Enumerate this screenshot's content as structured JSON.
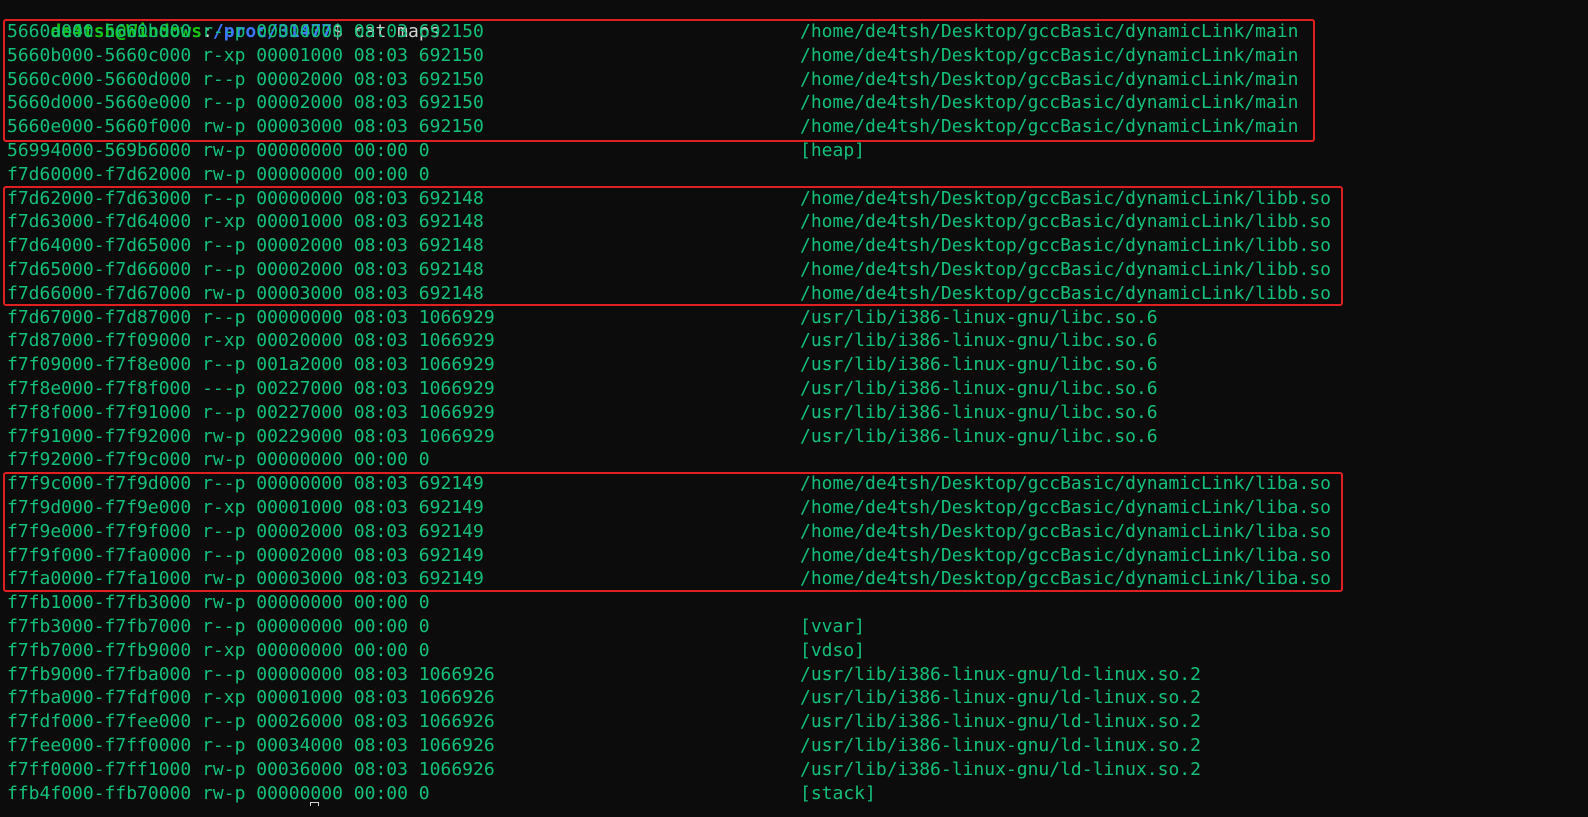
{
  "prompt": {
    "user_host": "de4tsh@Windows",
    "separator": ":",
    "path": "/proc/31477",
    "dollar": "$ ",
    "command": "cat maps"
  },
  "rows": [
    {
      "cols": "5660a000-5660b000 r--p 00000000 08:03 692150",
      "path": "/home/de4tsh/Desktop/gccBasic/dynamicLink/main"
    },
    {
      "cols": "5660b000-5660c000 r-xp 00001000 08:03 692150",
      "path": "/home/de4tsh/Desktop/gccBasic/dynamicLink/main"
    },
    {
      "cols": "5660c000-5660d000 r--p 00002000 08:03 692150",
      "path": "/home/de4tsh/Desktop/gccBasic/dynamicLink/main"
    },
    {
      "cols": "5660d000-5660e000 r--p 00002000 08:03 692150",
      "path": "/home/de4tsh/Desktop/gccBasic/dynamicLink/main"
    },
    {
      "cols": "5660e000-5660f000 rw-p 00003000 08:03 692150",
      "path": "/home/de4tsh/Desktop/gccBasic/dynamicLink/main"
    },
    {
      "cols": "56994000-569b6000 rw-p 00000000 00:00 0",
      "path": "[heap]"
    },
    {
      "cols": "f7d60000-f7d62000 rw-p 00000000 00:00 0",
      "path": ""
    },
    {
      "cols": "f7d62000-f7d63000 r--p 00000000 08:03 692148",
      "path": "/home/de4tsh/Desktop/gccBasic/dynamicLink/libb.so"
    },
    {
      "cols": "f7d63000-f7d64000 r-xp 00001000 08:03 692148",
      "path": "/home/de4tsh/Desktop/gccBasic/dynamicLink/libb.so"
    },
    {
      "cols": "f7d64000-f7d65000 r--p 00002000 08:03 692148",
      "path": "/home/de4tsh/Desktop/gccBasic/dynamicLink/libb.so"
    },
    {
      "cols": "f7d65000-f7d66000 r--p 00002000 08:03 692148",
      "path": "/home/de4tsh/Desktop/gccBasic/dynamicLink/libb.so"
    },
    {
      "cols": "f7d66000-f7d67000 rw-p 00003000 08:03 692148",
      "path": "/home/de4tsh/Desktop/gccBasic/dynamicLink/libb.so"
    },
    {
      "cols": "f7d67000-f7d87000 r--p 00000000 08:03 1066929",
      "path": "/usr/lib/i386-linux-gnu/libc.so.6"
    },
    {
      "cols": "f7d87000-f7f09000 r-xp 00020000 08:03 1066929",
      "path": "/usr/lib/i386-linux-gnu/libc.so.6"
    },
    {
      "cols": "f7f09000-f7f8e000 r--p 001a2000 08:03 1066929",
      "path": "/usr/lib/i386-linux-gnu/libc.so.6"
    },
    {
      "cols": "f7f8e000-f7f8f000 ---p 00227000 08:03 1066929",
      "path": "/usr/lib/i386-linux-gnu/libc.so.6"
    },
    {
      "cols": "f7f8f000-f7f91000 r--p 00227000 08:03 1066929",
      "path": "/usr/lib/i386-linux-gnu/libc.so.6"
    },
    {
      "cols": "f7f91000-f7f92000 rw-p 00229000 08:03 1066929",
      "path": "/usr/lib/i386-linux-gnu/libc.so.6"
    },
    {
      "cols": "f7f92000-f7f9c000 rw-p 00000000 00:00 0",
      "path": ""
    },
    {
      "cols": "f7f9c000-f7f9d000 r--p 00000000 08:03 692149",
      "path": "/home/de4tsh/Desktop/gccBasic/dynamicLink/liba.so"
    },
    {
      "cols": "f7f9d000-f7f9e000 r-xp 00001000 08:03 692149",
      "path": "/home/de4tsh/Desktop/gccBasic/dynamicLink/liba.so"
    },
    {
      "cols": "f7f9e000-f7f9f000 r--p 00002000 08:03 692149",
      "path": "/home/de4tsh/Desktop/gccBasic/dynamicLink/liba.so"
    },
    {
      "cols": "f7f9f000-f7fa0000 r--p 00002000 08:03 692149",
      "path": "/home/de4tsh/Desktop/gccBasic/dynamicLink/liba.so"
    },
    {
      "cols": "f7fa0000-f7fa1000 rw-p 00003000 08:03 692149",
      "path": "/home/de4tsh/Desktop/gccBasic/dynamicLink/liba.so"
    },
    {
      "cols": "f7fb1000-f7fb3000 rw-p 00000000 00:00 0",
      "path": ""
    },
    {
      "cols": "f7fb3000-f7fb7000 r--p 00000000 00:00 0",
      "path": "[vvar]"
    },
    {
      "cols": "f7fb7000-f7fb9000 r-xp 00000000 00:00 0",
      "path": "[vdso]"
    },
    {
      "cols": "f7fb9000-f7fba000 r--p 00000000 08:03 1066926",
      "path": "/usr/lib/i386-linux-gnu/ld-linux.so.2"
    },
    {
      "cols": "f7fba000-f7fdf000 r-xp 00001000 08:03 1066926",
      "path": "/usr/lib/i386-linux-gnu/ld-linux.so.2"
    },
    {
      "cols": "f7fdf000-f7fee000 r--p 00026000 08:03 1066926",
      "path": "/usr/lib/i386-linux-gnu/ld-linux.so.2"
    },
    {
      "cols": "f7fee000-f7ff0000 r--p 00034000 08:03 1066926",
      "path": "/usr/lib/i386-linux-gnu/ld-linux.so.2"
    },
    {
      "cols": "f7ff0000-f7ff1000 rw-p 00036000 08:03 1066926",
      "path": "/usr/lib/i386-linux-gnu/ld-linux.so.2"
    },
    {
      "cols": "ffb4f000-ffb70000 rw-p 00000000 00:00 0",
      "path": "[stack]"
    }
  ],
  "colors": {
    "background": "#0c0c0c",
    "text": "#13c07a",
    "prompt_user": "#16c60c",
    "prompt_path": "#3b78ff",
    "highlight_border": "#e02020"
  }
}
